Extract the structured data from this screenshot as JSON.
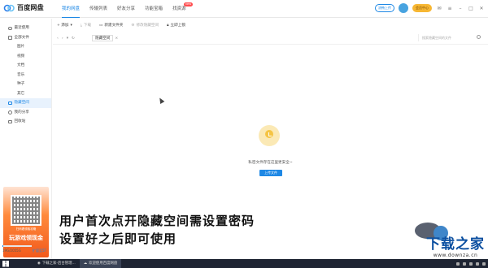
{
  "app": {
    "title": "百度网盘",
    "tabs": [
      {
        "label": "我的网盘"
      },
      {
        "label": "传输列表"
      },
      {
        "label": "好友分享"
      },
      {
        "label": "功能宝箱"
      },
      {
        "label": "找资源",
        "badge": "new"
      }
    ],
    "transfer_button": "流畅上传",
    "vip_button": "会员中心"
  },
  "sidebar": {
    "items": [
      {
        "label": "最近使用",
        "icon": "clock-icon"
      },
      {
        "label": "全部文件",
        "icon": "folder-icon"
      },
      {
        "label": "图片",
        "sub": true
      },
      {
        "label": "视频",
        "sub": true
      },
      {
        "label": "文档",
        "sub": true
      },
      {
        "label": "音乐",
        "sub": true
      },
      {
        "label": "种子",
        "sub": true
      },
      {
        "label": "其它",
        "sub": true
      },
      {
        "label": "隐藏空间",
        "icon": "lock-icon",
        "active": true
      },
      {
        "label": "我的分享",
        "icon": "share-icon"
      },
      {
        "label": "回收站",
        "icon": "trash-icon"
      }
    ],
    "promo": {
      "small_text": "扫码看领取攻略",
      "big_text": "玩游戏领现金"
    },
    "storage": {
      "text": "19G/2055G",
      "used_fraction": 0.01
    },
    "expand_label": "扩容至5T"
  },
  "toolbar": {
    "add_label": "+ 添加",
    "download_label": "下载",
    "new_folder_label": "新建文件夹",
    "hidden_settings_label": "修改隐藏空间",
    "lock_label": "立即上锁"
  },
  "addressbar": {
    "crumb": "隐藏空间",
    "search_placeholder": "搜索隐藏空间的文件"
  },
  "content": {
    "empty_text": "私密文件存在这里更安全~",
    "upload_label": "上传文件"
  },
  "overlay": {
    "line1": "用户首次点开隐藏空间需设置密码",
    "line2": "设置好之后即可使用",
    "watermark_title": "下载之家",
    "watermark_url": "www.downza.cn"
  },
  "taskbar": {
    "tasks": [
      {
        "label": "下载之家-后台管理..."
      },
      {
        "label": "欢迎使用百度网盘",
        "active": true
      }
    ]
  },
  "colors": {
    "accent": "#1e88e5",
    "vip": "#f7b733"
  }
}
